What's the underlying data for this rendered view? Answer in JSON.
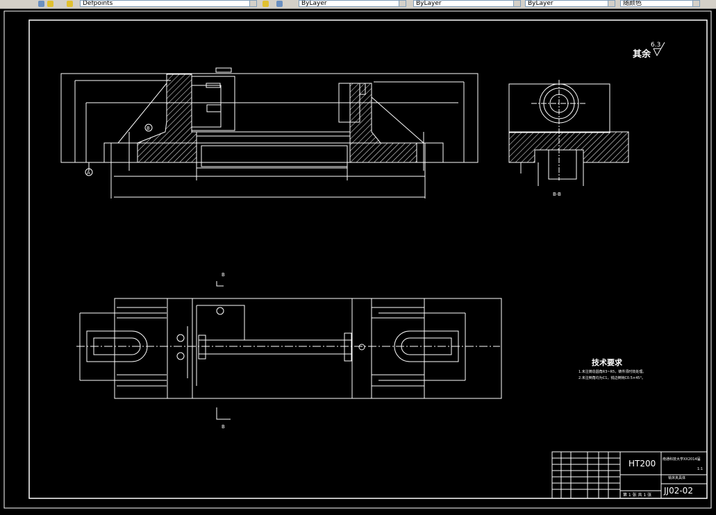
{
  "toolbar": {
    "layer_value": "Defpoints",
    "color_value": "ByLayer",
    "linetype_value": "ByLayer",
    "lineweight_value": "ByLayer",
    "plotstyle_value": "随颜色"
  },
  "drawing": {
    "roughness_label": "其余",
    "roughness_value": "6.3",
    "section_label": "B-B",
    "section_mark_top": "B",
    "section_mark_bottom": "B",
    "datum_a": "A",
    "datum_b": "B",
    "tech_title": "技术要求",
    "tech_line1": "1.未注铸造圆角R3~R5，铸件须时效处理。",
    "tech_line2": "2.未注倒角均为C1，锐边倒钝C0.5×45°。",
    "title_block": {
      "material": "HT200",
      "school": "南通科技大学XX2014届",
      "part_name": "铣床夹具体",
      "drawing_no": "JJ02-02",
      "scale": "1:1",
      "sheet": "第 1 张 共 1 张"
    }
  },
  "colors": {
    "background": "#000000",
    "line": "#ffffff",
    "toolbar": "#d4d0c8"
  }
}
